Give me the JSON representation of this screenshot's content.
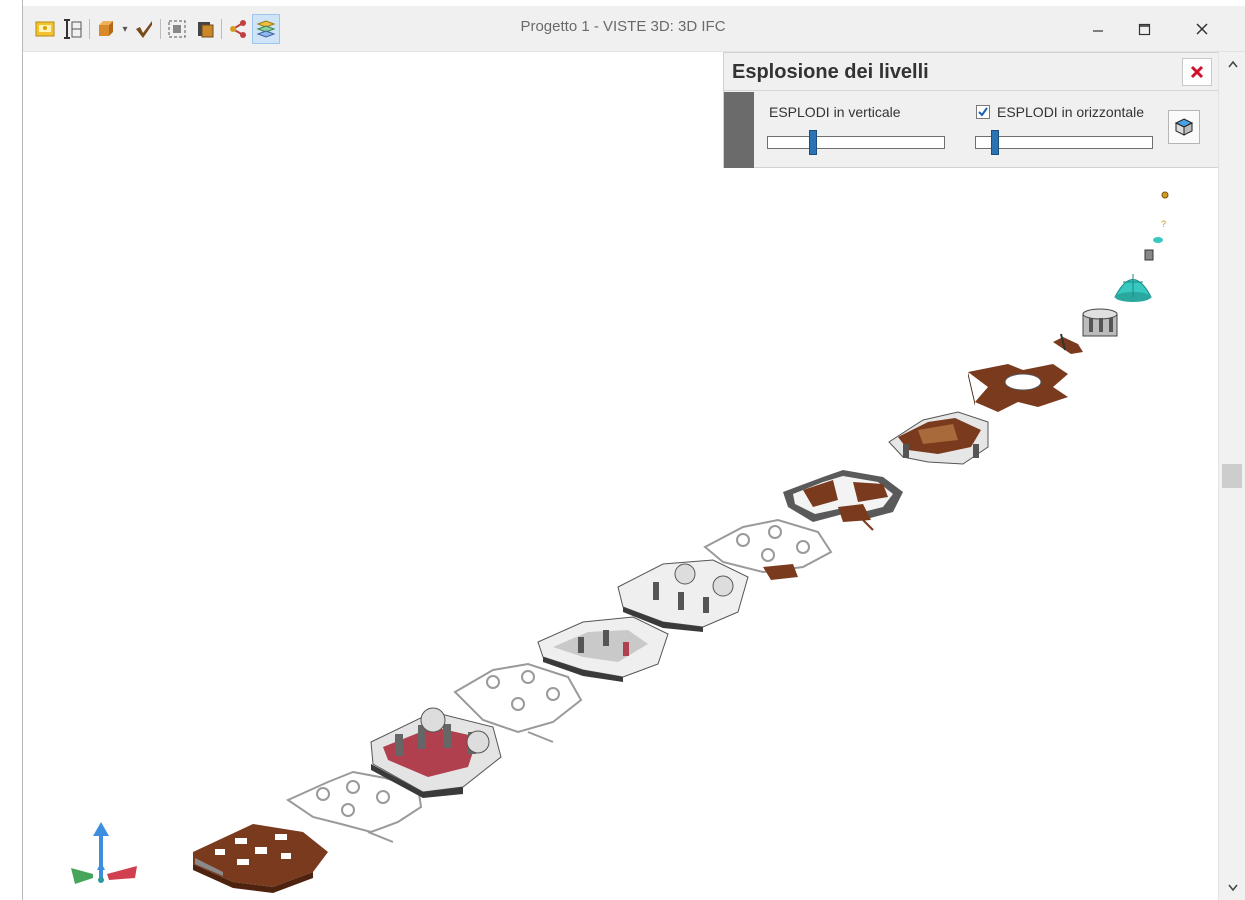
{
  "window": {
    "title": "Progetto 1 -  VISTE 3D: 3D IFC",
    "controls": {
      "minimize": "minimize-icon",
      "maximize": "maximize-icon",
      "close": "close-icon"
    }
  },
  "toolbar": {
    "buttons": [
      {
        "icon": "image-icon"
      },
      {
        "icon": "level-height-icon"
      },
      {
        "icon": "solid-box-icon",
        "has_dropdown": true
      },
      {
        "icon": "section-cut-icon"
      },
      {
        "icon": "zoom-extents-icon"
      },
      {
        "icon": "render-cube-icon"
      },
      {
        "icon": "share-icon"
      },
      {
        "icon": "explode-levels-icon",
        "active": true
      }
    ]
  },
  "explode_panel": {
    "title": "Esplosione dei livelli",
    "vertical_label": "ESPLODI in verticale",
    "horizontal_label": "ESPLODI in orizzontale",
    "horizontal_checked": true,
    "vertical_slider_value": 0.24,
    "horizontal_slider_value": 0.09,
    "action_icon": "3d-cube-icon"
  },
  "scene": {
    "description_levels": 14,
    "colors": {
      "wood": "#7a3a1e",
      "wall": "#d7d7d7",
      "glass": "#37c9c0",
      "accent": "#b0404e"
    }
  },
  "axis_gizmo": {
    "labels": [
      "y",
      "z",
      "x"
    ]
  }
}
